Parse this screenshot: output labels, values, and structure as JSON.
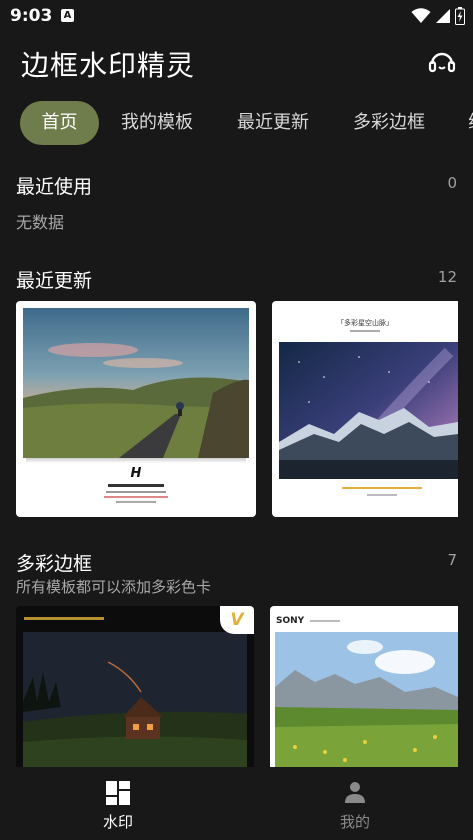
{
  "status": {
    "time": "9:03",
    "keyboard_badge": "A"
  },
  "app": {
    "title": "边框水印精灵",
    "support_icon": "headset-icon"
  },
  "tabs": [
    {
      "label": "首页",
      "active": true
    },
    {
      "label": "我的模板",
      "active": false
    },
    {
      "label": "最近更新",
      "active": false
    },
    {
      "label": "多彩边框",
      "active": false
    },
    {
      "label": "线",
      "active": false
    }
  ],
  "recent": {
    "title": "最近使用",
    "count": "0",
    "empty": "无数据"
  },
  "updates": {
    "title": "最近更新",
    "count": "12"
  },
  "colorful": {
    "title": "多彩边框",
    "count": "7",
    "subtitle": "所有模板都可以添加多彩色卡"
  },
  "cards": {
    "road_logo": "H",
    "mountain_caption": "「多彩星空山脉」",
    "vip_badge": "V",
    "sony_brand": "SONY"
  },
  "colors": {
    "accent": "#6f7c4b",
    "background": "#181818",
    "vip": "#e2b13c"
  },
  "bottom_nav": [
    {
      "label": "水印",
      "icon": "dashboard-icon",
      "active": true
    },
    {
      "label": "我的",
      "icon": "person-icon",
      "active": false
    }
  ]
}
